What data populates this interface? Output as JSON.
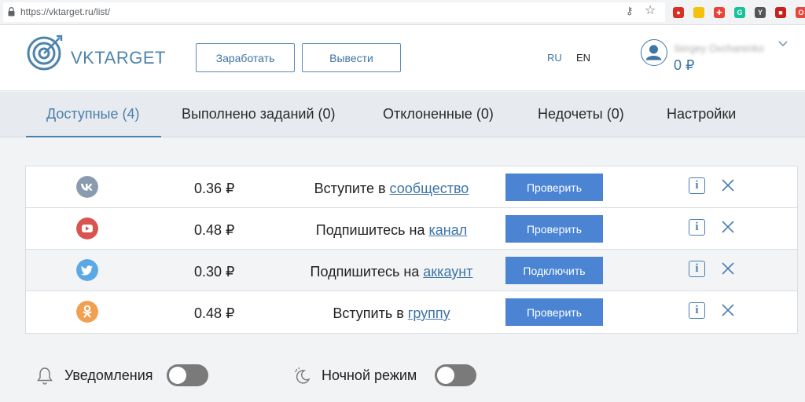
{
  "browser": {
    "url": "https://vktarget.ru/list/",
    "extensions": [
      {
        "name": "ext-red-icon",
        "color": "#d93025",
        "glyph": "●"
      },
      {
        "name": "ext-note-icon",
        "color": "#f4c20d",
        "glyph": ""
      },
      {
        "name": "ext-puzzle-icon",
        "color": "#ea4335",
        "glyph": "✚"
      },
      {
        "name": "ext-grammarly-icon",
        "color": "#15c39a",
        "glyph": "G"
      },
      {
        "name": "ext-y-icon",
        "color": "#555555",
        "glyph": "Y"
      },
      {
        "name": "ext-stop-icon",
        "color": "#c5221f",
        "glyph": "■"
      },
      {
        "name": "ext-opera-icon",
        "color": "#e8453c",
        "glyph": "O"
      }
    ]
  },
  "header": {
    "logo_text": "VKTARGET",
    "earn_label": "Заработать",
    "withdraw_label": "Вывести",
    "lang_ru": "RU",
    "lang_en": "EN",
    "username": "Sergey Ovcharenko",
    "balance": "0 ₽"
  },
  "tabs": [
    {
      "label": "Доступные (4)",
      "active": true
    },
    {
      "label": "Выполнено заданий (0)",
      "active": false
    },
    {
      "label": "Отклоненные (0)",
      "active": false
    },
    {
      "label": "Недочеты (0)",
      "active": false
    },
    {
      "label": "Настройки",
      "active": false
    }
  ],
  "tasks": [
    {
      "network": "vk",
      "icon_color": "#8a9bb0",
      "price": "0.36 ₽",
      "text": "Вступите в ",
      "link": "сообщество",
      "button": "Проверить"
    },
    {
      "network": "youtube",
      "icon_color": "#d9534f",
      "price": "0.48 ₽",
      "text": "Подпишитесь на ",
      "link": "канал",
      "button": "Проверить"
    },
    {
      "network": "twitter",
      "icon_color": "#5aa9e6",
      "price": "0.30 ₽",
      "text": "Подпишитесь на ",
      "link": "аккаунт",
      "button": "Подключить"
    },
    {
      "network": "odnoklassniki",
      "icon_color": "#f0a050",
      "price": "0.48 ₽",
      "text": "Вступить в ",
      "link": "группу",
      "button": "Проверить"
    }
  ],
  "settings": {
    "notifications_label": "Уведомления",
    "night_mode_label": "Ночной режим",
    "notifications_on": false,
    "night_mode_on": false
  },
  "colors": {
    "accent": "#4a80ae",
    "button_blue": "#4a84d3"
  }
}
